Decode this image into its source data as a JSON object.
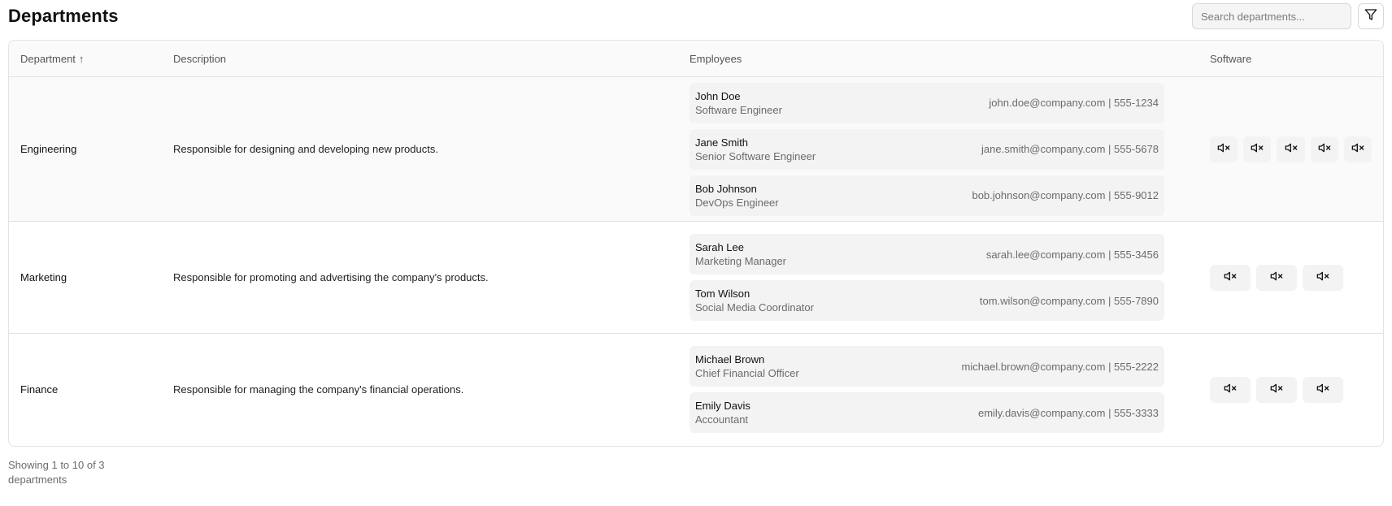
{
  "header": {
    "title": "Departments",
    "search_placeholder": "Search departments..."
  },
  "table": {
    "columns": {
      "department": "Department",
      "description": "Description",
      "employees": "Employees",
      "software": "Software"
    },
    "sort_indicator": "↑",
    "rows": [
      {
        "department": "Engineering",
        "description": "Responsible for designing and developing new products.",
        "employees": [
          {
            "name": "John Doe",
            "role": "Software Engineer",
            "contact": "john.doe@company.com | 555-1234"
          },
          {
            "name": "Jane Smith",
            "role": "Senior Software Engineer",
            "contact": "jane.smith@company.com | 555-5678"
          },
          {
            "name": "Bob Johnson",
            "role": "DevOps Engineer",
            "contact": "bob.johnson@company.com | 555-9012"
          }
        ],
        "software_count": 5
      },
      {
        "department": "Marketing",
        "description": "Responsible for promoting and advertising the company's products.",
        "employees": [
          {
            "name": "Sarah Lee",
            "role": "Marketing Manager",
            "contact": "sarah.lee@company.com | 555-3456"
          },
          {
            "name": "Tom Wilson",
            "role": "Social Media Coordinator",
            "contact": "tom.wilson@company.com | 555-7890"
          }
        ],
        "software_count": 3
      },
      {
        "department": "Finance",
        "description": "Responsible for managing the company's financial operations.",
        "employees": [
          {
            "name": "Michael Brown",
            "role": "Chief Financial Officer",
            "contact": "michael.brown@company.com | 555-2222"
          },
          {
            "name": "Emily Davis",
            "role": "Accountant",
            "contact": "emily.davis@company.com | 555-3333"
          }
        ],
        "software_count": 3
      }
    ]
  },
  "footer": {
    "summary": "Showing 1 to 10 of 3 departments"
  },
  "icons": {
    "filter": "filter-icon",
    "software": "muted-speaker-icon"
  }
}
